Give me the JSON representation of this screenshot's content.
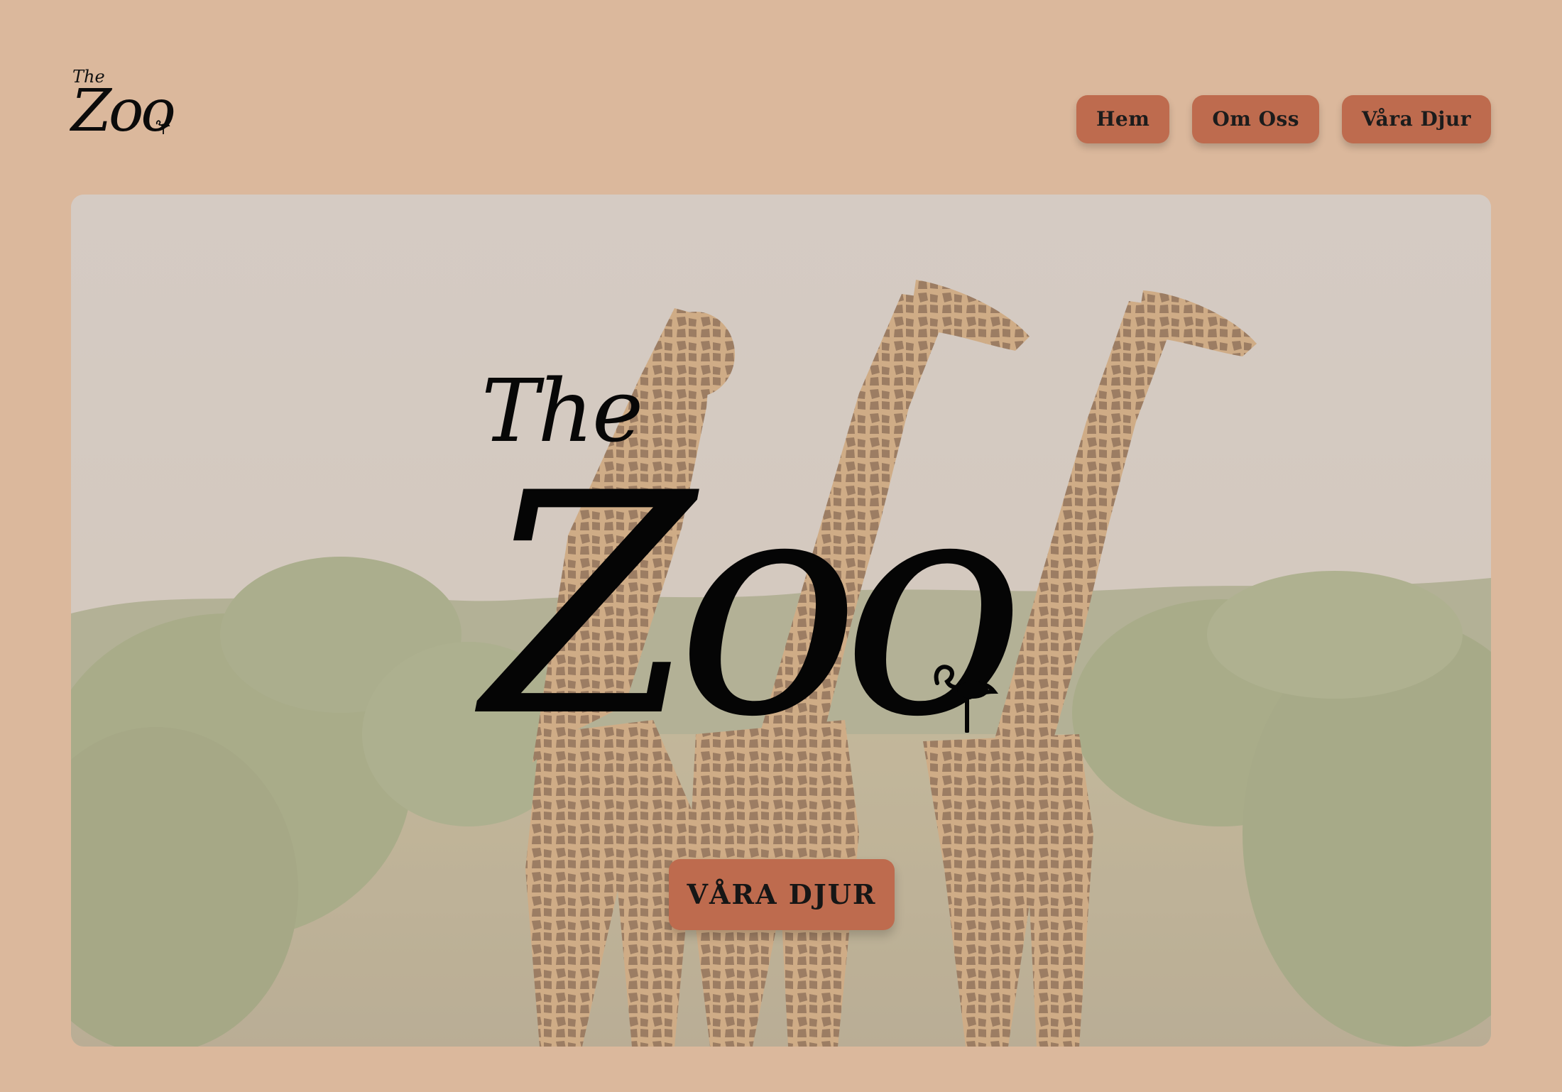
{
  "header": {
    "logo": {
      "the": "The",
      "zoo": "Zoo"
    },
    "nav": [
      {
        "label": "Hem"
      },
      {
        "label": "Om Oss"
      },
      {
        "label": "Våra Djur"
      }
    ]
  },
  "hero": {
    "logo": {
      "the": "The",
      "zoo": "Zoo"
    },
    "cta_label": "VÅRA DJUR",
    "background_image": "giraffes-savanna"
  },
  "colors": {
    "page_background": "#DBB89C",
    "button_background": "#BE6B4E",
    "text": "#111111"
  }
}
